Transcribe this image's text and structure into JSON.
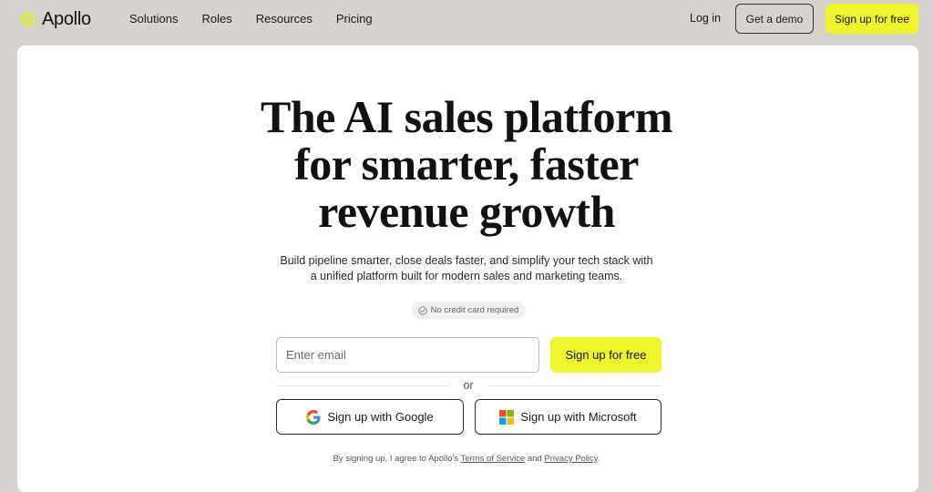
{
  "brand": {
    "name": "Apollo",
    "icon": "apollo-burst-icon",
    "icon_color": "#e3ee2b"
  },
  "nav": {
    "links": [
      "Solutions",
      "Roles",
      "Resources",
      "Pricing"
    ],
    "login_label": "Log in",
    "demo_label": "Get a demo",
    "signup_label": "Sign up for free"
  },
  "hero": {
    "headline_lines": [
      "The AI sales platform",
      "for smarter, faster",
      "revenue growth"
    ],
    "subtext_lines": [
      "Build pipeline smarter, close deals faster, and simplify your tech stack with",
      "a unified platform built for modern sales and marketing teams."
    ],
    "badge_text": "No credit card required",
    "badge_icon": "check-circle-icon"
  },
  "signup_form": {
    "email_placeholder": "Enter email",
    "email_value": "",
    "submit_label": "Sign up for free",
    "divider_text": "or",
    "google_label": "Sign up with Google",
    "microsoft_label": "Sign up with Microsoft"
  },
  "legal": {
    "prefix": "By signing up, I agree to Apollo's",
    "terms_label": "Terms of Service",
    "and": "and",
    "privacy_label": "Privacy Policy",
    "suffix": "."
  },
  "colors": {
    "accent": "#eef52a",
    "page_bg": "#d6d2cd",
    "card_bg": "#ffffff"
  }
}
